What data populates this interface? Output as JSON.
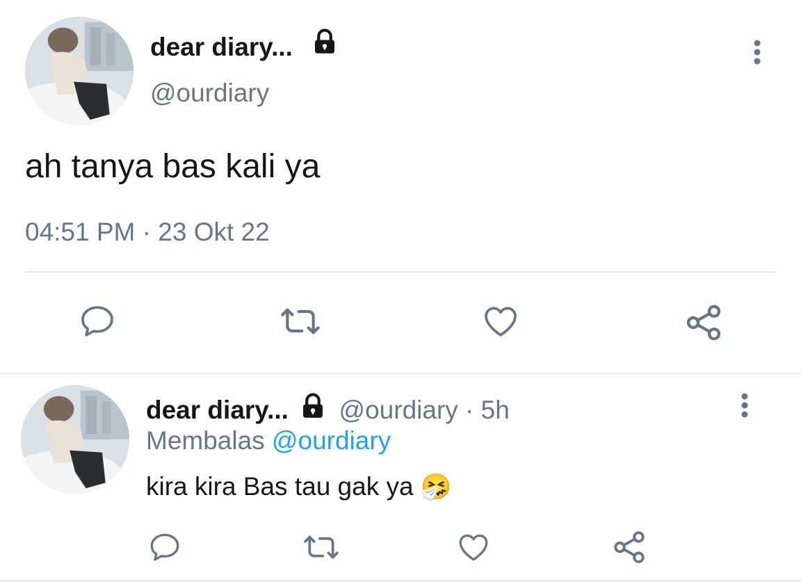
{
  "main_tweet": {
    "display_name": "dear diary...",
    "handle": "@ourdiary",
    "text": "ah tanya bas kali ya",
    "time": "04:51 PM",
    "separator": "·",
    "date": "23 Okt 22",
    "actions": [
      "reply-icon",
      "retweet-icon",
      "like-icon",
      "share-icon"
    ]
  },
  "reply_tweet": {
    "display_name": "dear diary...",
    "handle": "@ourdiary",
    "separator": "·",
    "age": "5h",
    "replying_prefix": "Membalas",
    "replying_to": "@ourdiary",
    "text": "kira kira Bas tau gak ya",
    "emoji": "🤧",
    "actions": [
      "reply-icon",
      "retweet-icon",
      "like-icon",
      "share-icon"
    ]
  },
  "colors": {
    "text": "#14171a",
    "muted": "#657786",
    "link": "#1da1f2",
    "icon": "#657786",
    "divider": "#e1e8ed"
  }
}
